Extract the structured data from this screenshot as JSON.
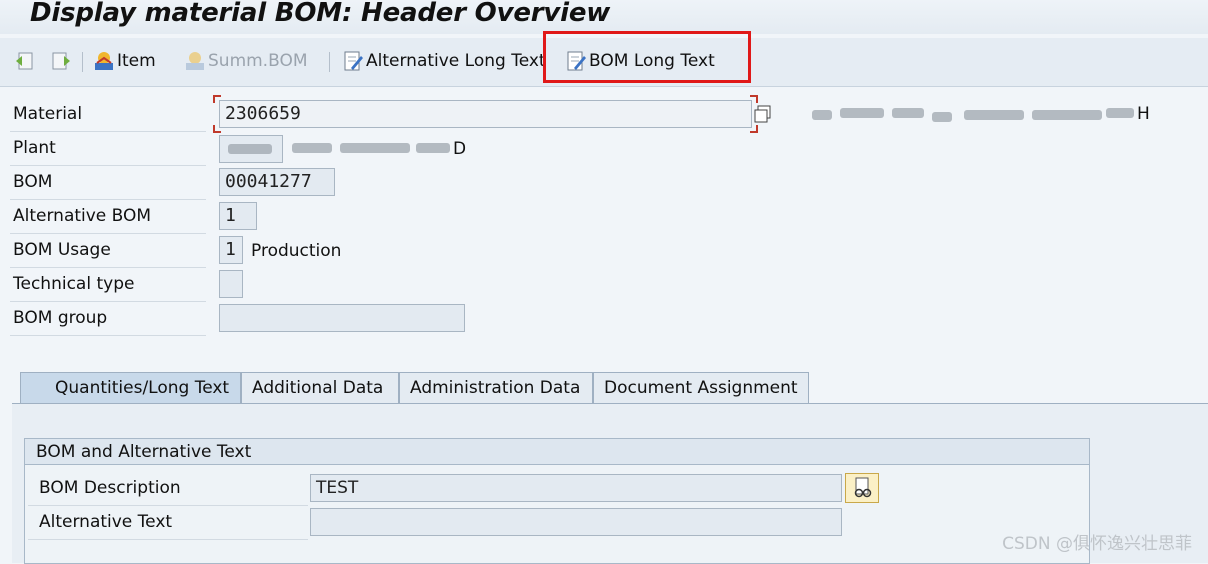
{
  "window": {
    "title": "Display material BOM: Header Overview"
  },
  "toolbar": {
    "item_label": "Item",
    "summ_bom_label": "Summ.BOM",
    "alt_long_text_label": "Alternative Long Text",
    "bom_long_text_label": "BOM Long Text"
  },
  "fields": {
    "material": {
      "label": "Material",
      "value": "2306659",
      "description_suffix": "H"
    },
    "plant": {
      "label": "Plant",
      "description_suffix": "D"
    },
    "bom": {
      "label": "BOM",
      "value": "00041277"
    },
    "alternative_bom": {
      "label": "Alternative BOM",
      "value": "1"
    },
    "bom_usage": {
      "label": "BOM Usage",
      "value": "1",
      "description": "Production"
    },
    "technical_type": {
      "label": "Technical type",
      "value": ""
    },
    "bom_group": {
      "label": "BOM group",
      "value": ""
    }
  },
  "tabs": [
    {
      "label": "Quantities/Long Text",
      "active": true
    },
    {
      "label": "Additional Data",
      "active": false
    },
    {
      "label": "Administration Data",
      "active": false
    },
    {
      "label": "Document Assignment",
      "active": false
    }
  ],
  "group": {
    "title": "BOM and Alternative Text",
    "bom_description": {
      "label": "BOM Description",
      "value": "TEST"
    },
    "alternative_text": {
      "label": "Alternative Text",
      "value": ""
    }
  },
  "watermark": "CSDN @俱怀逸兴壮思菲",
  "colors": {
    "highlight": "#e01818",
    "background": "#f1f5f9",
    "tab_active": "#c8d9ea"
  }
}
